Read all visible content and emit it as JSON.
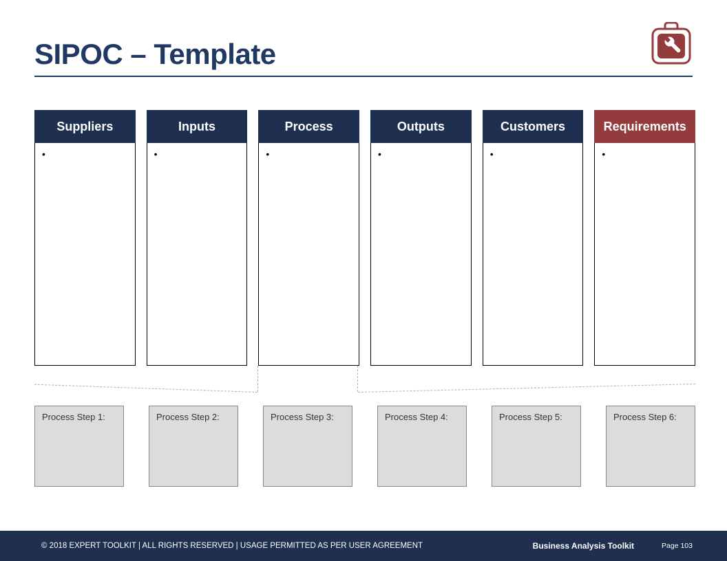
{
  "header": {
    "title": "SIPOC – Template"
  },
  "columns": [
    {
      "label": "Suppliers",
      "variant": "std",
      "body": "•"
    },
    {
      "label": "Inputs",
      "variant": "std",
      "body": "•"
    },
    {
      "label": "Process",
      "variant": "std",
      "body": "•"
    },
    {
      "label": "Outputs",
      "variant": "std",
      "body": "•"
    },
    {
      "label": "Customers",
      "variant": "std",
      "body": "•"
    },
    {
      "label": "Requirements",
      "variant": "req",
      "body": "•"
    }
  ],
  "steps": [
    {
      "label": "Process Step 1:"
    },
    {
      "label": "Process Step 2:"
    },
    {
      "label": "Process Step 3:"
    },
    {
      "label": "Process Step 4:"
    },
    {
      "label": "Process Step 5:"
    },
    {
      "label": "Process Step 6:"
    }
  ],
  "footer": {
    "copyright": "© 2018 EXPERT TOOLKIT | ALL RIGHTS RESERVED | USAGE PERMITTED AS PER USER AGREEMENT",
    "product": "Business Analysis Toolkit",
    "page": "Page 103"
  }
}
